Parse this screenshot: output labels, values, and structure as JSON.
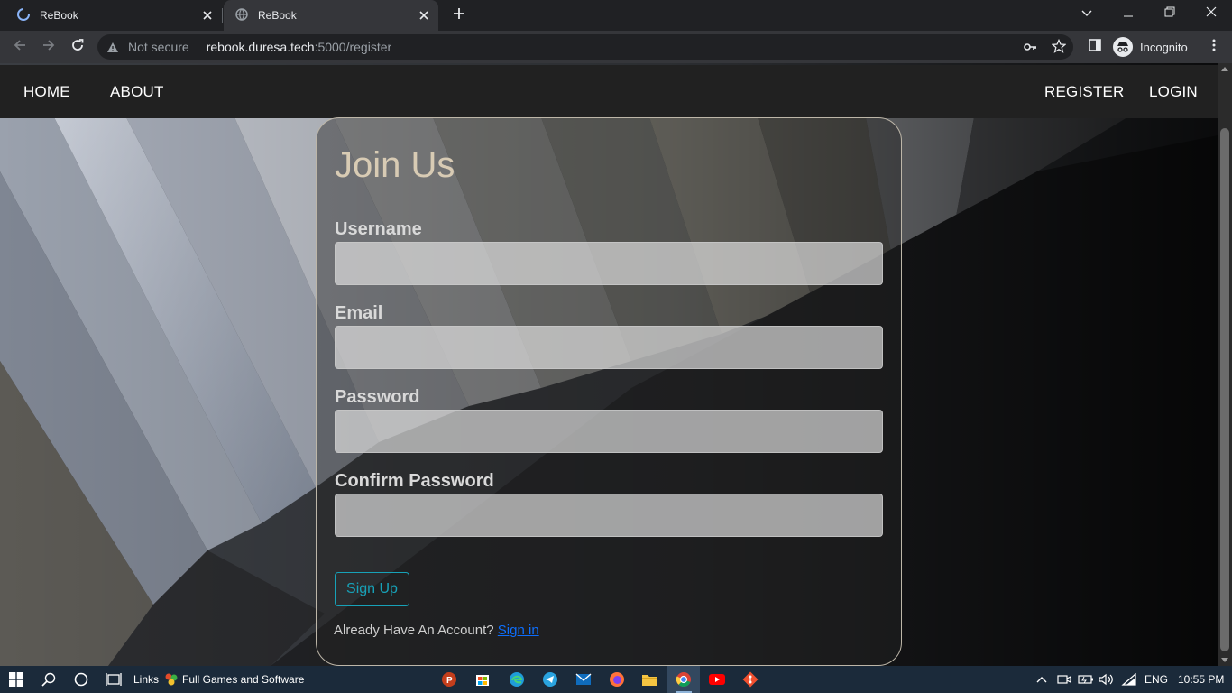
{
  "browser": {
    "tabs": [
      {
        "title": "ReBook",
        "state": "loading"
      },
      {
        "title": "ReBook",
        "state": "active"
      }
    ],
    "new_tab_icon": "plus-icon",
    "omnibox": {
      "security_label": "Not secure",
      "host": "rebook.duresa.tech",
      "path": ":5000/register"
    },
    "profile_label": "Incognito"
  },
  "page": {
    "nav": {
      "left": [
        "HOME",
        "ABOUT"
      ],
      "right": [
        "REGISTER",
        "LOGIN"
      ]
    },
    "form": {
      "title": "Join Us",
      "fields": [
        {
          "label": "Username",
          "value": "",
          "type": "text"
        },
        {
          "label": "Email",
          "value": "",
          "type": "email"
        },
        {
          "label": "Password",
          "value": "",
          "type": "password"
        },
        {
          "label": "Confirm Password",
          "value": "",
          "type": "password"
        }
      ],
      "submit_label": "Sign Up",
      "account_prompt": "Already Have An Account?",
      "signin_label": "Sign in"
    }
  },
  "colors": {
    "title": "#d8cbb4",
    "button_accent": "#17a2b8",
    "link": "#0d6efd",
    "navbar": "#212121",
    "taskbar": "#1b2a3a"
  },
  "taskbar": {
    "links_label": "Links",
    "shortcut_label": "Full Games and Software",
    "language": "ENG",
    "time": "10:55 PM",
    "pinned_icons": [
      "powerpoint-icon",
      "store-icon",
      "edge-icon",
      "telegram-icon",
      "mail-icon",
      "firefox-icon",
      "file-explorer-icon",
      "chrome-icon",
      "youtube-icon",
      "git-icon"
    ]
  }
}
